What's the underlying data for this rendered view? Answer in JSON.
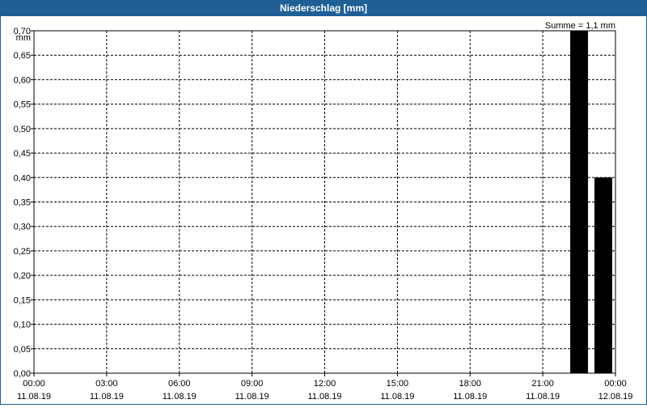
{
  "window": {
    "title": "Niederschlag [mm]"
  },
  "chart_data": {
    "type": "bar",
    "title": "Niederschlag [mm]",
    "ylabel": "mm",
    "summary": "Summe = 1,1 mm",
    "ylim": [
      0,
      0.7
    ],
    "y_ticks": [
      "0,00",
      "0,05",
      "0,10",
      "0,15",
      "0,20",
      "0,25",
      "0,30",
      "0,35",
      "0,40",
      "0,45",
      "0,50",
      "0,55",
      "0,60",
      "0,65",
      "0,70"
    ],
    "x_ticks": [
      {
        "time": "00:00",
        "date": "11.08.19"
      },
      {
        "time": "03:00",
        "date": "11.08.19"
      },
      {
        "time": "06:00",
        "date": "11.08.19"
      },
      {
        "time": "09:00",
        "date": "11.08.19"
      },
      {
        "time": "12:00",
        "date": "11.08.19"
      },
      {
        "time": "15:00",
        "date": "11.08.19"
      },
      {
        "time": "18:00",
        "date": "11.08.19"
      },
      {
        "time": "21:00",
        "date": "11.08.19"
      },
      {
        "time": "00:00",
        "date": "12.08.19"
      }
    ],
    "x_range": [
      "11.08.19 00:00",
      "12.08.19 00:00"
    ],
    "series": [
      {
        "bar_color": "#000000",
        "points": [
          {
            "start": "11.08.19 22:00",
            "end": "11.08.19 23:00",
            "value": 0.7
          },
          {
            "start": "11.08.19 23:00",
            "end": "12.08.19 00:00",
            "value": 0.4
          }
        ]
      }
    ],
    "grid": true
  }
}
